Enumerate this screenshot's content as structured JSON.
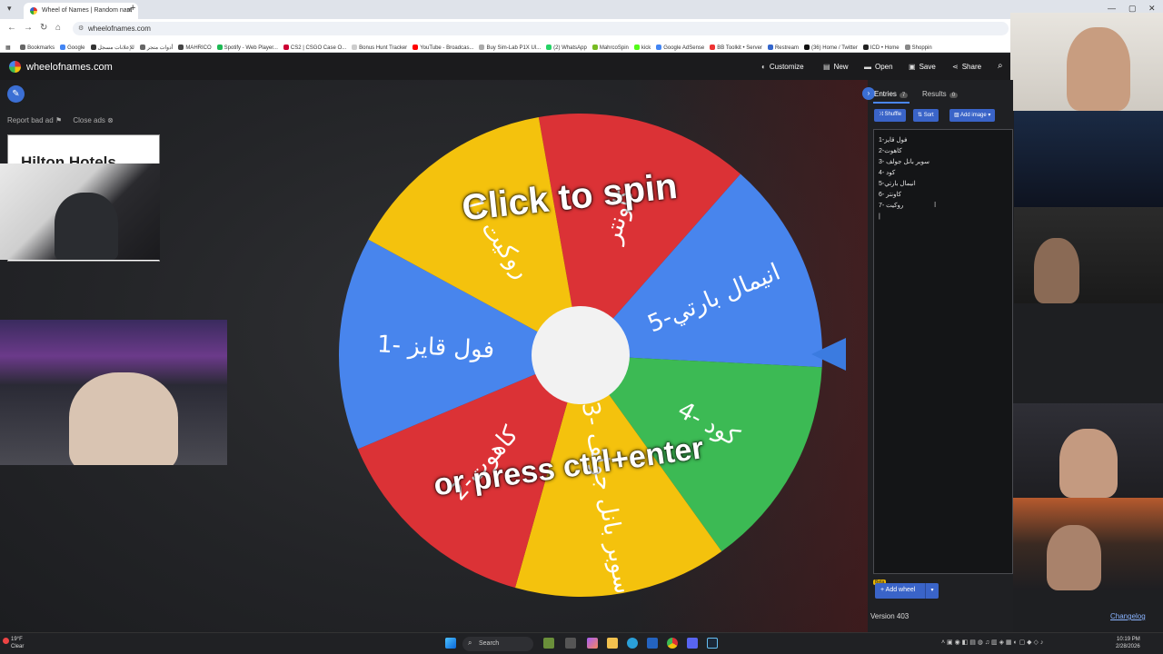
{
  "browser": {
    "tab_title": "Wheel of Names | Random nam",
    "url": "wheelofnames.com",
    "bookmarks": [
      {
        "label": "Bookmarks",
        "color": "#666"
      },
      {
        "label": "Google",
        "color": "#4285f4"
      },
      {
        "label": "للإعلانات مسجل",
        "color": "#333"
      },
      {
        "label": "أدوات متجر",
        "color": "#666"
      },
      {
        "label": "MAHRICO",
        "color": "#444"
      },
      {
        "label": "Spotify - Web Player...",
        "color": "#1db954"
      },
      {
        "label": "CS2 | CSGO Case O...",
        "color": "#c03"
      },
      {
        "label": "Bonus Hunt Tracker",
        "color": "#ccc"
      },
      {
        "label": "YouTube - Broadcas...",
        "color": "#f00"
      },
      {
        "label": "Buy Sim-Lab P1X Ul...",
        "color": "#aaa"
      },
      {
        "label": "(2) WhatsApp",
        "color": "#25d366"
      },
      {
        "label": "MahrcoSpin",
        "color": "#7b2"
      },
      {
        "label": "kick",
        "color": "#53fc18"
      },
      {
        "label": "Google AdSense",
        "color": "#4285f4"
      },
      {
        "label": "BB Toolkit • Server",
        "color": "#e33"
      },
      {
        "label": "Restream",
        "color": "#36c"
      },
      {
        "label": "(36) Home / Twitter",
        "color": "#111"
      },
      {
        "label": "ICD • Home",
        "color": "#222"
      },
      {
        "label": "Shoppin",
        "color": "#888"
      }
    ]
  },
  "site": {
    "brand": "wheelofnames.com",
    "menu": [
      {
        "label": "Customize",
        "icon": "palette-icon"
      },
      {
        "label": "New",
        "icon": "file-icon"
      },
      {
        "label": "Open",
        "icon": "folder-icon"
      },
      {
        "label": "Save",
        "icon": "save-icon"
      },
      {
        "label": "Share",
        "icon": "share-icon"
      }
    ],
    "report_bad_ad": "Report bad ad",
    "close_ads": "Close ads",
    "ad_text": "Hilton Hotels"
  },
  "wheel": {
    "center_prompt_1": "Click to spin",
    "center_prompt_2": "or press ctrl+enter",
    "colors": {
      "red": "#db3236",
      "blue": "#4885ed",
      "green": "#3cba54",
      "yellow": "#f4c20d"
    },
    "segments": [
      {
        "label": "كاونتر",
        "color": "#db3236"
      },
      {
        "label": "انيمال بارتي-5",
        "color": "#4885ed"
      },
      {
        "label": "4- كود",
        "color": "#3cba54"
      },
      {
        "label": "3- سوبر بانل جولف",
        "color": "#f4c20d"
      },
      {
        "label": "كاهوت-2",
        "color": "#db3236"
      },
      {
        "label": "1- فول قايز",
        "color": "#4885ed"
      },
      {
        "label": "روكيت -7",
        "color": "#f4c20d"
      }
    ]
  },
  "panel": {
    "tab_entries": "Entries",
    "entries_count": "7",
    "tab_results": "Results",
    "results_count": "0",
    "shuffle": "Shuffle",
    "sort": "Sort",
    "add_image": "Add image",
    "entries": [
      "فول قايز-1",
      "كاهوت-2",
      "3- سوبر بانل جولف",
      "4- كود",
      "انيمال بارتي-5",
      "6- كاونتر",
      "7- روكيت"
    ],
    "beta": "Beta",
    "add_wheel": "Add wheel",
    "version": "Version 403",
    "changelog": "Changelog"
  },
  "taskbar": {
    "temp": "19°F",
    "weather": "Clear",
    "search": "Search",
    "time": "10:19 PM",
    "date": "2/28/2026"
  }
}
